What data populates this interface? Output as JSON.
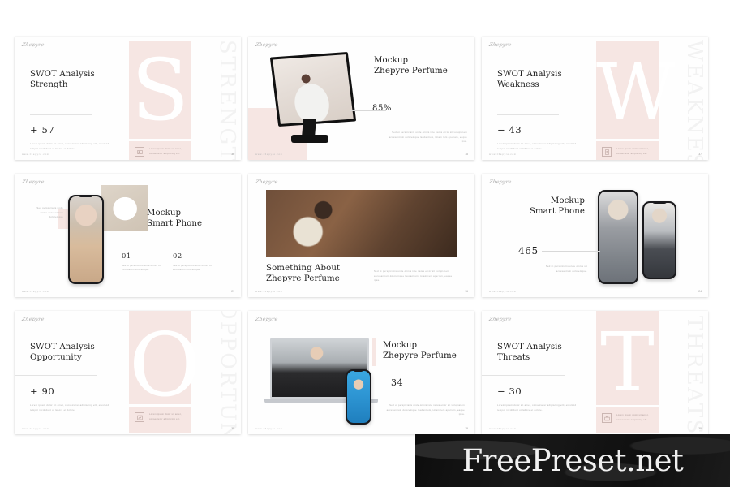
{
  "page": {
    "background_color": "#ffffff",
    "blush_color": "#f6e6e3",
    "ink_color": "#1d1d1d",
    "muted_color": "#adadad"
  },
  "brand": {
    "logo": "Zhepyre",
    "website": "www.zhepyre.com"
  },
  "watermark": {
    "text": "FreePreset.net"
  },
  "lorem": {
    "two_line": "Lorem ipsum dolor sit amet, consectetur adipiscing elit, eiusmod tempor incididunt ut labore et dolore.",
    "icon_caption": "Lorem ipsum dolor sit amet, consectetur adipiscing elit.",
    "right_block": "Sed ut perspiciatis unde omnis iste natus error sit voluptatem accusantium doloremque laudantium, totam rem aperiam, eaque ipsa.",
    "short_block": "Sed ut perspiciatis unde omnis sit accusantium doloremque.",
    "num_block": "Sed ut perspiciatis unde omnis ut voluptatem doloremque.",
    "side_block": "Sed perspiciatis unde omnis accusantium doloremque"
  },
  "slides": [
    {
      "id": "swot-strength",
      "kind": "swot",
      "title_line1": "SWOT Analysis",
      "title_line2": "Strength",
      "stat": "+ 57",
      "big_letter": "S",
      "vertical_word": "STRENGTH",
      "page_number": "36",
      "icon": "image-icon"
    },
    {
      "id": "mockup-perfume-monitor",
      "kind": "monitor",
      "title_line1": "Mockup",
      "title_line2": "Zhepyre Perfume",
      "stat": "85%",
      "page_number": "18"
    },
    {
      "id": "swot-weakness",
      "kind": "swot",
      "title_line1": "SWOT Analysis",
      "title_line2": "Weakness",
      "stat": "−  43",
      "big_letter": "W",
      "vertical_word": "WEAKNESS",
      "page_number": "37",
      "icon": "document-icon"
    },
    {
      "id": "mockup-smartphone-single",
      "kind": "phone-single",
      "title_line1": "Mockup",
      "title_line2": "Smart Phone",
      "items": [
        {
          "number": "01",
          "text": "Sed ut perspiciatis unde omnis ut voluptatem doloremque."
        },
        {
          "number": "02",
          "text": "Sed ut perspiciatis unde omnis ut voluptatem doloremque."
        }
      ],
      "page_number": "21"
    },
    {
      "id": "about-perfume",
      "kind": "about",
      "title_line1": "Something About",
      "title_line2": "Zhepyre Perfume",
      "page_number": "16"
    },
    {
      "id": "mockup-smartphone-duo",
      "kind": "phone-duo",
      "title_line1": "Mockup",
      "title_line2": "Smart Phone",
      "stat": "465",
      "page_number": "24"
    },
    {
      "id": "swot-opportunity",
      "kind": "swot",
      "title_line1": "SWOT Analysis",
      "title_line2": "Opportunity",
      "stat": "+ 90",
      "big_letter": "O",
      "vertical_word": "OPPORTUNITY",
      "page_number": "38",
      "icon": "chart-icon"
    },
    {
      "id": "mockup-perfume-laptop",
      "kind": "laptop",
      "title_line1": "Mockup",
      "title_line2": "Zhepyre Perfume",
      "stat": "34",
      "page_number": "19"
    },
    {
      "id": "swot-threats",
      "kind": "swot",
      "title_line1": "SWOT Analysis",
      "title_line2": "Threats",
      "stat": "−  30",
      "big_letter": "T",
      "vertical_word": "THREATS",
      "page_number": "39",
      "icon": "briefcase-icon"
    }
  ]
}
